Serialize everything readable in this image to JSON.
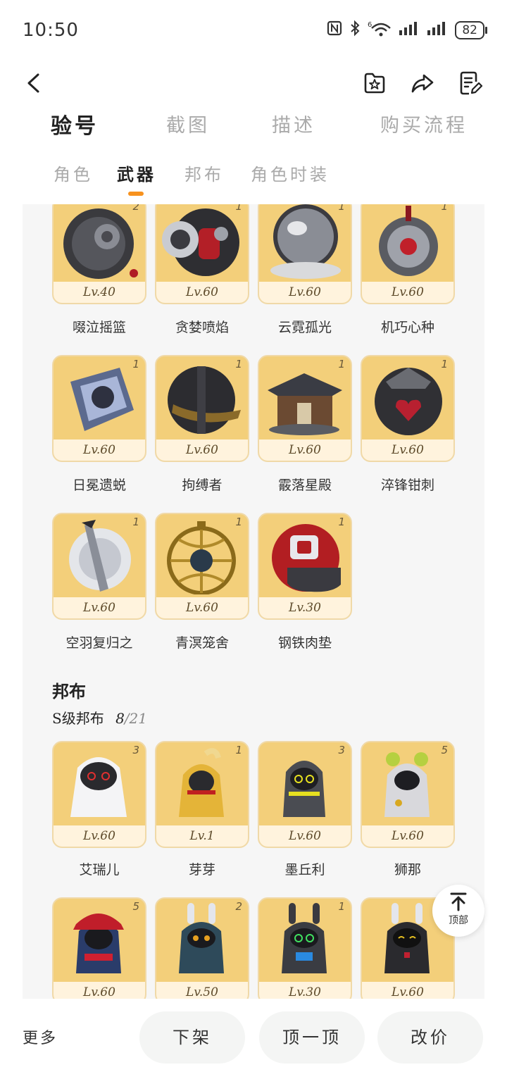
{
  "status_bar": {
    "time": "10:50",
    "battery": "82",
    "signal_label": "6"
  },
  "tabs_main": [
    {
      "label": "验号"
    },
    {
      "label": "截图"
    },
    {
      "label": "描述"
    },
    {
      "label": "购买流程"
    }
  ],
  "tabs_sub": [
    {
      "label": "角色"
    },
    {
      "label": "武器"
    },
    {
      "label": "邦布"
    },
    {
      "label": "角色时装"
    }
  ],
  "weapons": [
    {
      "name": "啜泣摇篮",
      "level": "Lv.40",
      "count": "2"
    },
    {
      "name": "贪婪喷焰",
      "level": "Lv.60",
      "count": "1"
    },
    {
      "name": "云霓孤光",
      "level": "Lv.60",
      "count": "1"
    },
    {
      "name": "机巧心种",
      "level": "Lv.60",
      "count": "1"
    },
    {
      "name": "日冕遗蜕",
      "level": "Lv.60",
      "count": "1"
    },
    {
      "name": "拘缚者",
      "level": "Lv.60",
      "count": "1"
    },
    {
      "name": "霰落星殿",
      "level": "Lv.60",
      "count": "1"
    },
    {
      "name": "淬锋钳刺",
      "level": "Lv.60",
      "count": "1"
    },
    {
      "name": "空羽复归之",
      "level": "Lv.60",
      "count": "1"
    },
    {
      "name": "青溟笼舍",
      "level": "Lv.60",
      "count": "1"
    },
    {
      "name": "钢铁肉垫",
      "level": "Lv.30",
      "count": "1"
    }
  ],
  "bangboo_section": {
    "title": "邦布",
    "subtitle": "S级邦布",
    "owned": "8",
    "total": "/21"
  },
  "bangboos": [
    {
      "name": "艾瑞儿",
      "level": "Lv.60",
      "count": "3"
    },
    {
      "name": "芽芽",
      "level": "Lv.1",
      "count": "1"
    },
    {
      "name": "墨丘利",
      "level": "Lv.60",
      "count": "3"
    },
    {
      "name": "狮那",
      "level": "Lv.60",
      "count": "5"
    },
    {
      "name": "",
      "level": "Lv.60",
      "count": "5"
    },
    {
      "name": "",
      "level": "Lv.50",
      "count": "2"
    },
    {
      "name": "",
      "level": "Lv.30",
      "count": "1"
    },
    {
      "name": "",
      "level": "Lv.60",
      "count": "1"
    }
  ],
  "floating": {
    "top_label": "顶部"
  },
  "bottom_bar": {
    "more": "更多",
    "delist": "下架",
    "bump": "顶一顶",
    "reprice": "改价"
  },
  "colors": {
    "accent": "#f7921e",
    "card_bg": "#f3cf7a",
    "level_bar": "#fff3dd"
  }
}
